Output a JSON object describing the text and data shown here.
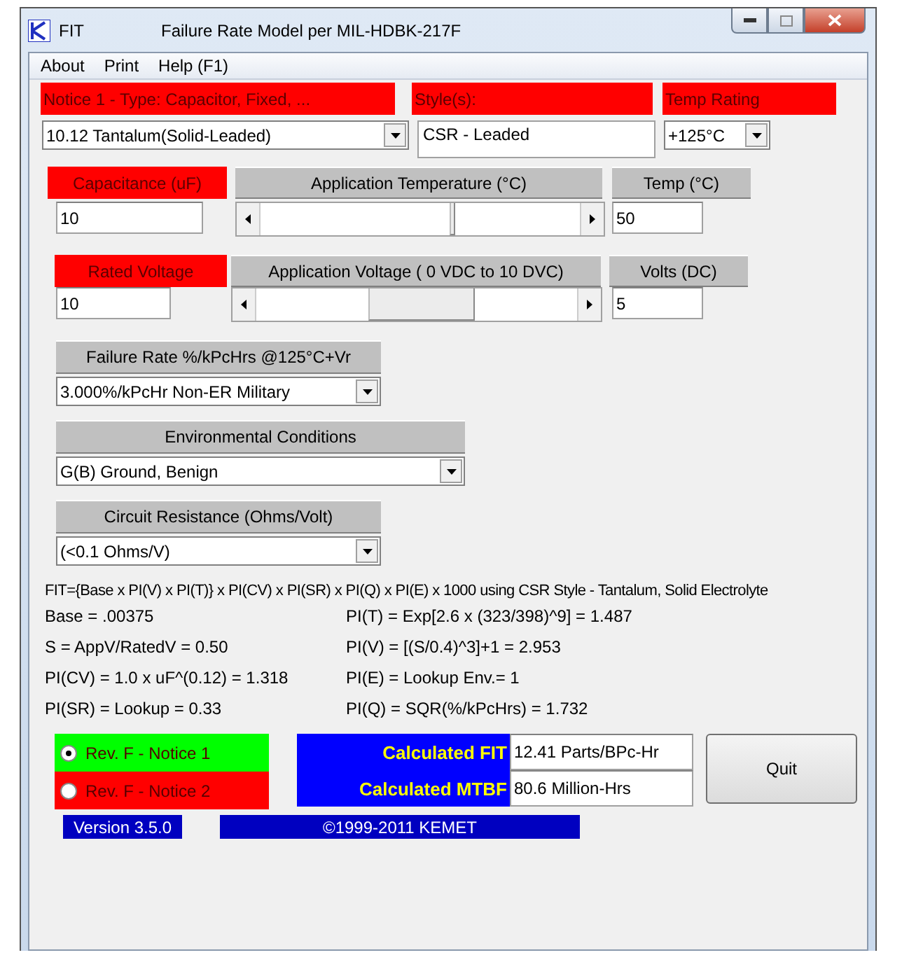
{
  "window": {
    "app_name": "FIT",
    "title": "Failure Rate Model per MIL-HDBK-217F"
  },
  "menu": [
    "About",
    "Print",
    "Help (F1)"
  ],
  "part_type": {
    "label": "Notice 1 - Type: Capacitor, Fixed, ...",
    "required": true,
    "value": "10.12 Tantalum(Solid-Leaded)"
  },
  "style": {
    "label": "Style(s):",
    "required": true,
    "value": "CSR - Leaded"
  },
  "temp_rating": {
    "label": "Temp Rating",
    "required": true,
    "value": "+125°C"
  },
  "capacitance": {
    "label": "Capacitance (uF)",
    "required": true,
    "value": "10"
  },
  "application_temperature": {
    "label": "Application Temperature (°C)",
    "required": false
  },
  "temp": {
    "label": "Temp (°C)",
    "required": false,
    "value": "50"
  },
  "rated_voltage": {
    "label": "Rated Voltage",
    "required": true,
    "value": "10"
  },
  "application_voltage": {
    "label": "Application Voltage ( 0 VDC to 10 DVC)",
    "required": false
  },
  "volts": {
    "label": "Volts (DC)",
    "required": false,
    "value": "5"
  },
  "failure_rate": {
    "label": "Failure Rate %/kPcHrs @125°C+Vr",
    "required": false,
    "value": "3.000%/kPcHr Non-ER Military"
  },
  "environment": {
    "label": "Environmental Conditions",
    "required": false,
    "value": "G(B)  Ground, Benign"
  },
  "circuit_resistance": {
    "label": "Circuit Resistance (Ohms/Volt)",
    "required": false,
    "value": "(<0.1 Ohms/V)"
  },
  "formula": "FIT={Base x PI(V) x PI(T)} x PI(CV) x PI(SR) x PI(Q) x PI(E) x 1000   using CSR Style - Tantalum, Solid Electrolyte",
  "factors": [
    [
      "Base = .00375",
      "PI(T) = Exp[2.6 x (323/398)^9] = 1.487"
    ],
    [
      "S = AppV/RatedV = 0.50",
      "PI(V) = [(S/0.4)^3]+1 = 2.953"
    ],
    [
      "PI(CV) = 1.0 x uF^(0.12) = 1.318",
      "PI(E) = Lookup Env.= 1"
    ],
    [
      "PI(SR) = Lookup = 0.33",
      "PI(Q) = SQR(%/kPcHrs) = 1.732"
    ]
  ],
  "revisions": [
    {
      "label": "Rev. F - Notice 1",
      "selected": true,
      "color": "#00ff00"
    },
    {
      "label": "Rev. F - Notice 2",
      "selected": false,
      "color": "#ff0000"
    }
  ],
  "results": [
    {
      "label": "Calculated FIT",
      "value": "12.41 Parts/BPc-Hr"
    },
    {
      "label": "Calculated MTBF",
      "value": "80.6 Million-Hrs"
    }
  ],
  "quit_button": "Quit",
  "version": "Version 3.5.0",
  "copyright": "©1999-2011 KEMET"
}
